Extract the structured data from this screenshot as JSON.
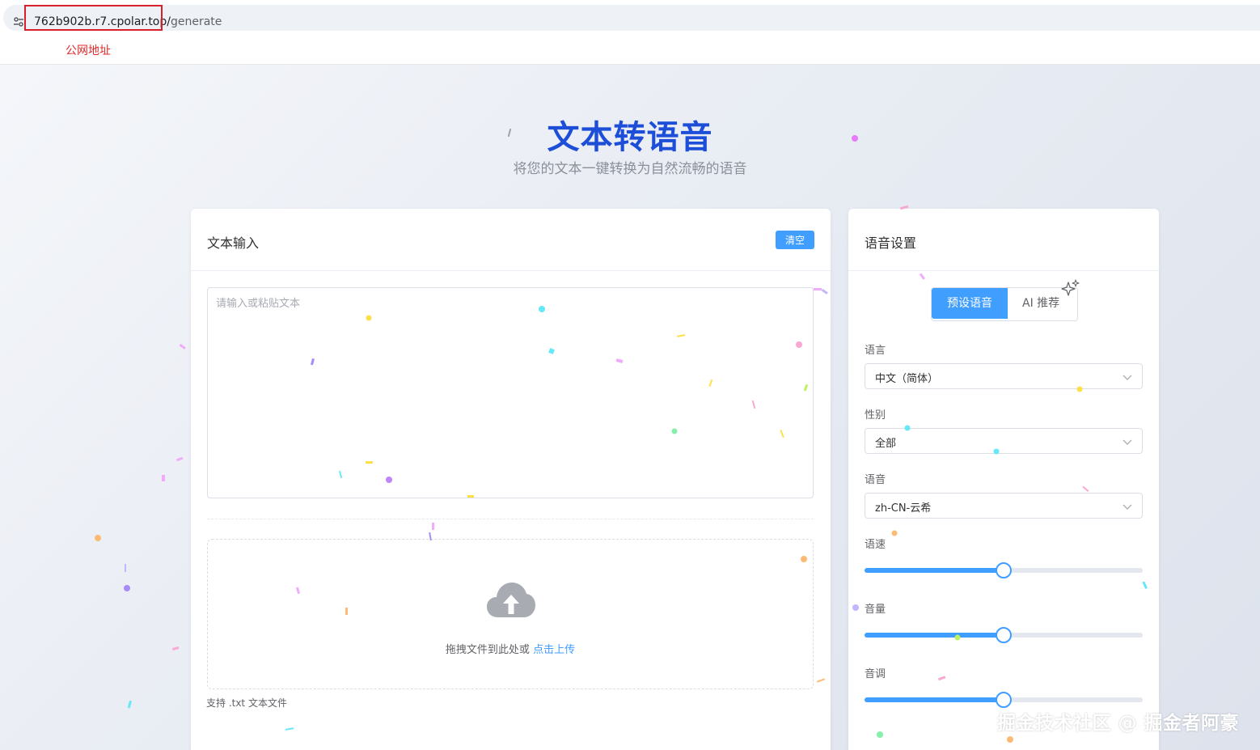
{
  "browser": {
    "url_host": "762b902b.r7.cpolar.top/",
    "url_path": "generate",
    "annotation": "公网地址"
  },
  "hero": {
    "title": "文本转语音",
    "subtitle": "将您的文本一键转换为自然流畅的语音"
  },
  "text_input": {
    "title": "文本输入",
    "clear_label": "清空",
    "placeholder": "请输入或粘贴文本",
    "upload_text": "拖拽文件到此处或 ",
    "upload_link": "点击上传",
    "tip": "支持 .txt 文本文件"
  },
  "voice_settings": {
    "title": "语音设置",
    "tabs": [
      {
        "label": "预设语音",
        "active": true
      },
      {
        "label": "AI 推荐",
        "active": false
      }
    ],
    "language_label": "语言",
    "language_value": "中文（简体）",
    "gender_label": "性别",
    "gender_value": "全部",
    "voice_label": "语音",
    "voice_value": "zh-CN-云希",
    "speed_label": "语速",
    "speed_level": 0.5,
    "volume_label": "音量",
    "volume_level": 0.5,
    "pitch_label": "音调",
    "pitch_level": 0.5
  },
  "colors": {
    "accent": "#409eff",
    "title_blue": "#1d4ed8",
    "annotation_red": "#e02a2a"
  },
  "watermark": "掘金技术社区 @ 掘金者阿豪"
}
